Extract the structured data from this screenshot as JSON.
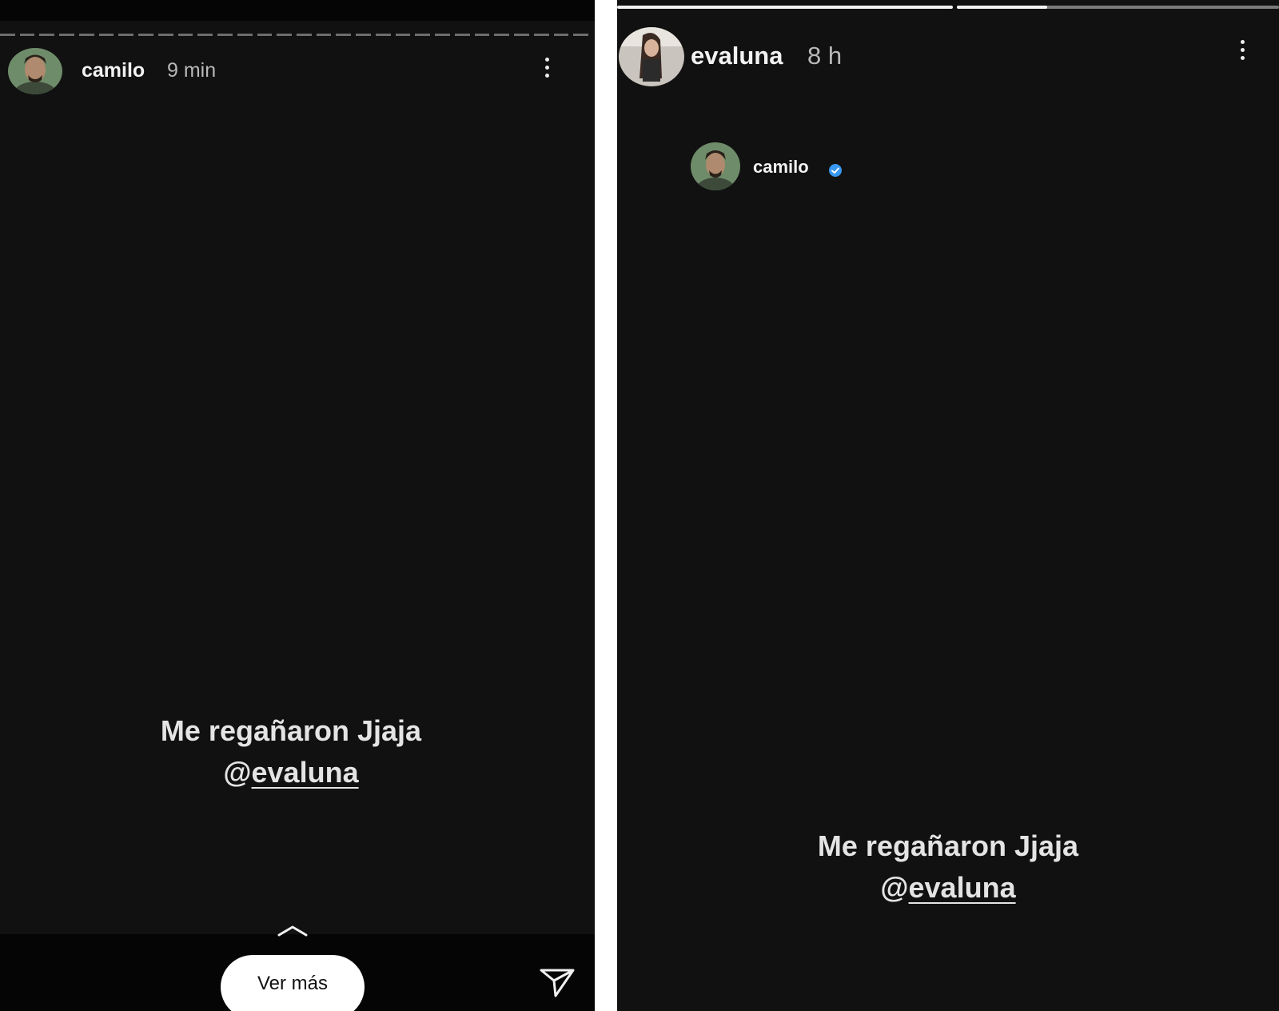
{
  "left_story": {
    "username": "camilo",
    "time": "9 min",
    "caption_line1": "Me regañaron Jjaja",
    "mention_at": "@",
    "mention_name": "evaluna",
    "see_more_label": "Ver más"
  },
  "right_story": {
    "username": "evaluna",
    "time": "8 h",
    "progress_second_fraction": 0.28,
    "shared_post_username": "camilo",
    "caption_line1": "Me regañaron Jjaja",
    "mention_at": "@",
    "mention_name": "evaluna"
  },
  "colors": {
    "story_background": "#111111",
    "text": "#f2f2f2",
    "verified_badge": "#3897f0"
  }
}
